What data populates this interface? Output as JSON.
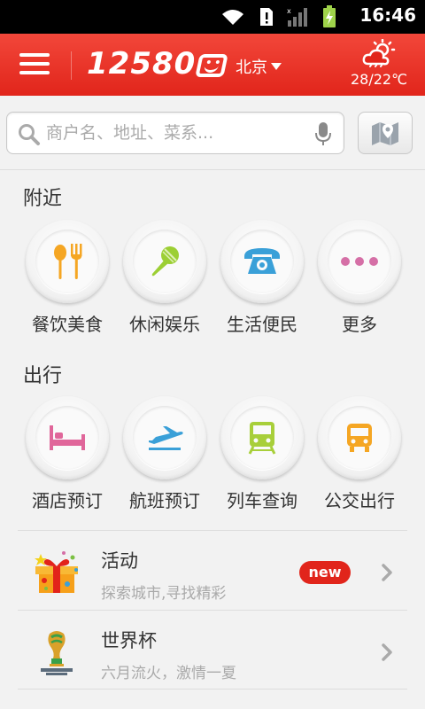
{
  "status_bar": {
    "time": "16:46",
    "icons": [
      "wifi-icon",
      "sim-alert-icon",
      "signal-icon",
      "battery-charging-icon"
    ]
  },
  "header": {
    "logo_text": "12580",
    "city": "北京",
    "weather_icon": "partly-cloudy-icon",
    "temperature": "28/22℃",
    "brand_color": "#e1251b"
  },
  "search": {
    "placeholder": "商户名、地址、菜系...",
    "value": ""
  },
  "nearby": {
    "title": "附近",
    "items": [
      {
        "label": "餐饮美食",
        "icon": "dining-icon"
      },
      {
        "label": "休闲娱乐",
        "icon": "microphone-icon"
      },
      {
        "label": "生活便民",
        "icon": "telephone-icon"
      },
      {
        "label": "更多",
        "icon": "more-dots-icon"
      }
    ]
  },
  "travel": {
    "title": "出行",
    "items": [
      {
        "label": "酒店预订",
        "icon": "bed-icon"
      },
      {
        "label": "航班预订",
        "icon": "airplane-icon"
      },
      {
        "label": "列车查询",
        "icon": "train-icon"
      },
      {
        "label": "公交出行",
        "icon": "bus-icon"
      }
    ]
  },
  "list": [
    {
      "title": "活动",
      "subtitle": "探索城市,寻找精彩",
      "badge": "new",
      "icon": "gift-box-icon"
    },
    {
      "title": "世界杯",
      "subtitle": "六月流火，激情一夏",
      "badge": "",
      "icon": "world-cup-trophy-icon"
    }
  ]
}
